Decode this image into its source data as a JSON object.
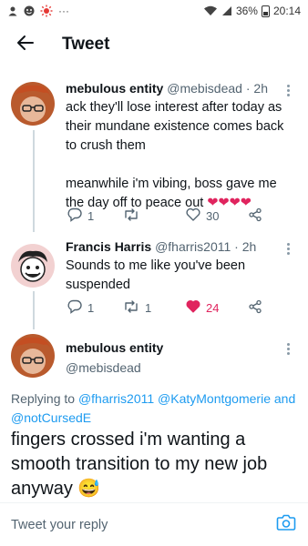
{
  "status_bar": {
    "battery": "36%",
    "time": "20:14",
    "more": "···"
  },
  "header": {
    "title": "Tweet"
  },
  "tweets": [
    {
      "name": "mebulous entity",
      "handle": "@mebisdead",
      "time": "2h",
      "text_lines": [
        "ack they'll lose interest after today as their mundane existence comes back to crush them",
        "meanwhile i'm vibing, boss gave me the day off to peace out"
      ],
      "emoji": "❤❤❤❤",
      "stats": {
        "replies": "1",
        "retweets": "",
        "likes": "30"
      }
    },
    {
      "name": "Francis Harris",
      "handle": "@fharris2011",
      "time": "2h",
      "text": "Sounds to me like you've been suspended",
      "stats": {
        "replies": "1",
        "retweets": "1",
        "likes": "24"
      }
    }
  ],
  "main_tweet": {
    "name": "mebulous entity",
    "handle": "@mebisdead",
    "replying_prefix": "Replying to",
    "replying_to": [
      "@fharris2011",
      "@KatyMontgomerie",
      "and",
      "@notCursedE"
    ],
    "text": "fingers crossed i'm wanting a smooth transition to my new job anyway",
    "emoji": "😅"
  },
  "reply_bar": {
    "placeholder": "Tweet your reply"
  },
  "colors": {
    "accent": "#1d9bf0",
    "like_active": "#e0245e",
    "secondary_text": "#536471"
  }
}
